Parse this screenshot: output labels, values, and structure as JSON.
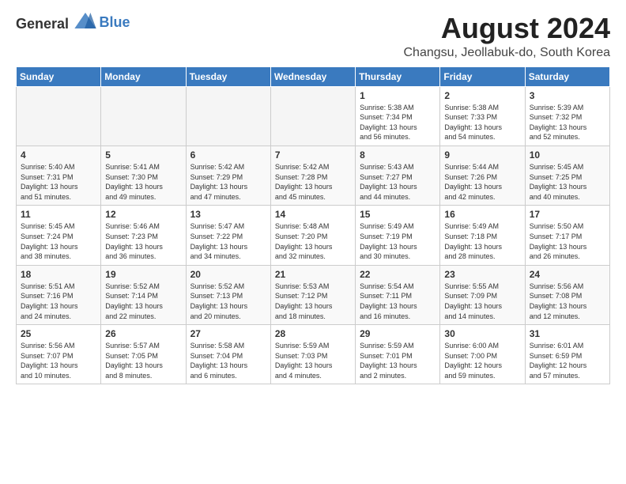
{
  "header": {
    "logo_general": "General",
    "logo_blue": "Blue",
    "month_year": "August 2024",
    "location": "Changsu, Jeollabuk-do, South Korea"
  },
  "weekdays": [
    "Sunday",
    "Monday",
    "Tuesday",
    "Wednesday",
    "Thursday",
    "Friday",
    "Saturday"
  ],
  "weeks": [
    [
      {
        "day": "",
        "info": ""
      },
      {
        "day": "",
        "info": ""
      },
      {
        "day": "",
        "info": ""
      },
      {
        "day": "",
        "info": ""
      },
      {
        "day": "1",
        "info": "Sunrise: 5:38 AM\nSunset: 7:34 PM\nDaylight: 13 hours\nand 56 minutes."
      },
      {
        "day": "2",
        "info": "Sunrise: 5:38 AM\nSunset: 7:33 PM\nDaylight: 13 hours\nand 54 minutes."
      },
      {
        "day": "3",
        "info": "Sunrise: 5:39 AM\nSunset: 7:32 PM\nDaylight: 13 hours\nand 52 minutes."
      }
    ],
    [
      {
        "day": "4",
        "info": "Sunrise: 5:40 AM\nSunset: 7:31 PM\nDaylight: 13 hours\nand 51 minutes."
      },
      {
        "day": "5",
        "info": "Sunrise: 5:41 AM\nSunset: 7:30 PM\nDaylight: 13 hours\nand 49 minutes."
      },
      {
        "day": "6",
        "info": "Sunrise: 5:42 AM\nSunset: 7:29 PM\nDaylight: 13 hours\nand 47 minutes."
      },
      {
        "day": "7",
        "info": "Sunrise: 5:42 AM\nSunset: 7:28 PM\nDaylight: 13 hours\nand 45 minutes."
      },
      {
        "day": "8",
        "info": "Sunrise: 5:43 AM\nSunset: 7:27 PM\nDaylight: 13 hours\nand 44 minutes."
      },
      {
        "day": "9",
        "info": "Sunrise: 5:44 AM\nSunset: 7:26 PM\nDaylight: 13 hours\nand 42 minutes."
      },
      {
        "day": "10",
        "info": "Sunrise: 5:45 AM\nSunset: 7:25 PM\nDaylight: 13 hours\nand 40 minutes."
      }
    ],
    [
      {
        "day": "11",
        "info": "Sunrise: 5:45 AM\nSunset: 7:24 PM\nDaylight: 13 hours\nand 38 minutes."
      },
      {
        "day": "12",
        "info": "Sunrise: 5:46 AM\nSunset: 7:23 PM\nDaylight: 13 hours\nand 36 minutes."
      },
      {
        "day": "13",
        "info": "Sunrise: 5:47 AM\nSunset: 7:22 PM\nDaylight: 13 hours\nand 34 minutes."
      },
      {
        "day": "14",
        "info": "Sunrise: 5:48 AM\nSunset: 7:20 PM\nDaylight: 13 hours\nand 32 minutes."
      },
      {
        "day": "15",
        "info": "Sunrise: 5:49 AM\nSunset: 7:19 PM\nDaylight: 13 hours\nand 30 minutes."
      },
      {
        "day": "16",
        "info": "Sunrise: 5:49 AM\nSunset: 7:18 PM\nDaylight: 13 hours\nand 28 minutes."
      },
      {
        "day": "17",
        "info": "Sunrise: 5:50 AM\nSunset: 7:17 PM\nDaylight: 13 hours\nand 26 minutes."
      }
    ],
    [
      {
        "day": "18",
        "info": "Sunrise: 5:51 AM\nSunset: 7:16 PM\nDaylight: 13 hours\nand 24 minutes."
      },
      {
        "day": "19",
        "info": "Sunrise: 5:52 AM\nSunset: 7:14 PM\nDaylight: 13 hours\nand 22 minutes."
      },
      {
        "day": "20",
        "info": "Sunrise: 5:52 AM\nSunset: 7:13 PM\nDaylight: 13 hours\nand 20 minutes."
      },
      {
        "day": "21",
        "info": "Sunrise: 5:53 AM\nSunset: 7:12 PM\nDaylight: 13 hours\nand 18 minutes."
      },
      {
        "day": "22",
        "info": "Sunrise: 5:54 AM\nSunset: 7:11 PM\nDaylight: 13 hours\nand 16 minutes."
      },
      {
        "day": "23",
        "info": "Sunrise: 5:55 AM\nSunset: 7:09 PM\nDaylight: 13 hours\nand 14 minutes."
      },
      {
        "day": "24",
        "info": "Sunrise: 5:56 AM\nSunset: 7:08 PM\nDaylight: 13 hours\nand 12 minutes."
      }
    ],
    [
      {
        "day": "25",
        "info": "Sunrise: 5:56 AM\nSunset: 7:07 PM\nDaylight: 13 hours\nand 10 minutes."
      },
      {
        "day": "26",
        "info": "Sunrise: 5:57 AM\nSunset: 7:05 PM\nDaylight: 13 hours\nand 8 minutes."
      },
      {
        "day": "27",
        "info": "Sunrise: 5:58 AM\nSunset: 7:04 PM\nDaylight: 13 hours\nand 6 minutes."
      },
      {
        "day": "28",
        "info": "Sunrise: 5:59 AM\nSunset: 7:03 PM\nDaylight: 13 hours\nand 4 minutes."
      },
      {
        "day": "29",
        "info": "Sunrise: 5:59 AM\nSunset: 7:01 PM\nDaylight: 13 hours\nand 2 minutes."
      },
      {
        "day": "30",
        "info": "Sunrise: 6:00 AM\nSunset: 7:00 PM\nDaylight: 12 hours\nand 59 minutes."
      },
      {
        "day": "31",
        "info": "Sunrise: 6:01 AM\nSunset: 6:59 PM\nDaylight: 12 hours\nand 57 minutes."
      }
    ]
  ]
}
